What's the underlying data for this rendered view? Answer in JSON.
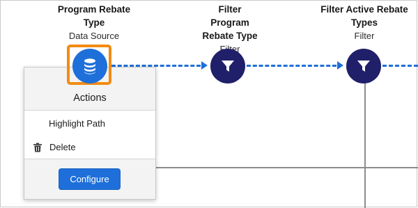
{
  "nodes": [
    {
      "title": "Program Rebate Type",
      "subtitle": "Data Source",
      "icon": "database-icon",
      "color": "#1e6fd9",
      "selected": true
    },
    {
      "title": "Filter Program Rebate Type",
      "subtitle": "Filter",
      "icon": "filter-icon",
      "color": "#1f1f6a",
      "selected": false
    },
    {
      "title": "Filter Active Rebate Types",
      "subtitle": "Filter",
      "icon": "filter-icon",
      "color": "#1f1f6a",
      "selected": false
    }
  ],
  "actions_menu": {
    "header": "Actions",
    "items": [
      {
        "label": "Highlight Path",
        "icon": ""
      },
      {
        "label": "Delete",
        "icon": "trash-icon"
      }
    ],
    "configure_label": "Configure"
  },
  "colors": {
    "accent": "#1e6fd9",
    "filter_node": "#1f1f6a",
    "selection_outline": "#f28b12",
    "connector": "#1e6fd9"
  }
}
